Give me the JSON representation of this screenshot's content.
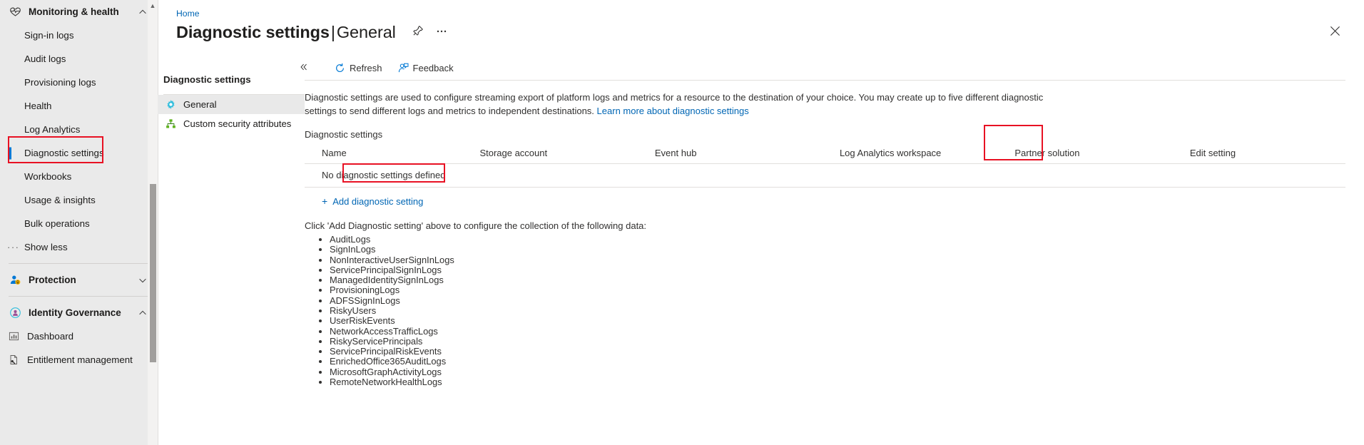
{
  "left_menu": {
    "groups": [
      {
        "label": "Monitoring & health",
        "icon": "heart-pulse-icon",
        "expanded": true,
        "chevron": "up"
      },
      {
        "label": "Protection",
        "icon": "user-shield-icon",
        "expanded": false,
        "chevron": "down"
      },
      {
        "label": "Identity Governance",
        "icon": "identity-governance-icon",
        "expanded": true,
        "chevron": "up"
      }
    ],
    "monitoring_items": [
      "Sign-in logs",
      "Audit logs",
      "Provisioning logs",
      "Health",
      "Log Analytics",
      "Diagnostic settings",
      "Workbooks",
      "Usage & insights",
      "Bulk operations"
    ],
    "selected_item": "Diagnostic settings",
    "show_less": "Show less",
    "identity_governance_items": [
      {
        "label": "Dashboard",
        "icon": "dashboard-icon"
      },
      {
        "label": "Entitlement management",
        "icon": "entitlement-icon"
      }
    ]
  },
  "blade": {
    "breadcrumb": "Home",
    "title_bold": "Diagnostic settings",
    "title_separator": "|",
    "title_light": "General",
    "pin_icon": "pin-icon",
    "more_icon": "ellipsis-icon",
    "close_icon": "close-icon"
  },
  "inner_nav": {
    "heading": "Diagnostic settings",
    "collapse_icon": "collapse-chevrons-icon",
    "items": [
      {
        "label": "General",
        "icon": "gear-icon",
        "selected": true
      },
      {
        "label": "Custom security attributes",
        "icon": "attributes-icon",
        "selected": false
      }
    ]
  },
  "toolbar": {
    "refresh_label": "Refresh",
    "refresh_icon": "refresh-icon",
    "feedback_label": "Feedback",
    "feedback_icon": "feedback-person-icon"
  },
  "content": {
    "description": "Diagnostic settings are used to configure streaming export of platform logs and metrics for a resource to the destination of your choice. You may create up to five different diagnostic settings to send different logs and metrics to independent destinations.",
    "learn_more": "Learn more about diagnostic settings",
    "section_label": "Diagnostic settings",
    "table": {
      "columns": [
        "Name",
        "Storage account",
        "Event hub",
        "Log Analytics workspace",
        "Partner solution",
        "Edit setting"
      ],
      "empty_message": "No diagnostic settings defined"
    },
    "add_setting_label": "Add diagnostic setting",
    "add_setting_plus": "+",
    "click_note": "Click 'Add Diagnostic setting' above to configure the collection of the following data:",
    "log_categories": [
      "AuditLogs",
      "SignInLogs",
      "NonInteractiveUserSignInLogs",
      "ServicePrincipalSignInLogs",
      "ManagedIdentitySignInLogs",
      "ProvisioningLogs",
      "ADFSSignInLogs",
      "RiskyUsers",
      "UserRiskEvents",
      "NetworkAccessTrafficLogs",
      "RiskyServicePrincipals",
      "ServicePrincipalRiskEvents",
      "EnrichedOffice365AuditLogs",
      "MicrosoftGraphActivityLogs",
      "RemoteNetworkHealthLogs"
    ]
  },
  "annotations": {
    "highlight_color": "#e81123",
    "boxes": [
      "diagnostic-settings-menu-item",
      "edit-setting-column",
      "add-diagnostic-setting-link"
    ]
  },
  "colors": {
    "accent": "#0078d4",
    "link": "#0066b4",
    "menu_bg": "#eaeaea",
    "selected_row": "#e9e9e9"
  }
}
